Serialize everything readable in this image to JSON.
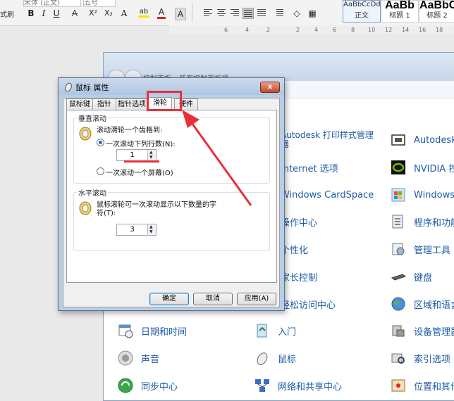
{
  "ribbon": {
    "format_painter_label": "式刷",
    "font_name": "宋体 (正文)",
    "font_size": "五号",
    "format_buttons": [
      "B",
      "I",
      "U",
      "A",
      "X²",
      "X₂",
      "A",
      "ab",
      "A",
      "A"
    ],
    "styles": [
      {
        "sample": "AaBbCcDd",
        "caption": "正文"
      },
      {
        "sample": "AaBb",
        "caption": "标题 1"
      },
      {
        "sample": "AaBbC",
        "caption": "标题 2"
      }
    ],
    "ruler_ticks": [
      "6",
      "4",
      "2",
      "2",
      "4",
      "6",
      "8",
      "10",
      "12",
      "14",
      "16",
      "18"
    ]
  },
  "control_panel": {
    "address": "控制面板 ▸ 所有控制面板项 ▸",
    "items": [
      {
        "label": "Autodesk 打印样式管理器",
        "icon": "printer-style-icon"
      },
      {
        "label": "Autodesk",
        "icon": "autodesk-icon"
      },
      {
        "label": "Internet 选项",
        "icon": "globe-icon"
      },
      {
        "label": "NVIDIA 控",
        "icon": "nvidia-icon"
      },
      {
        "label": "Windows CardSpace",
        "icon": "cardspace-icon"
      },
      {
        "label": "Windows",
        "icon": "windows-icon"
      },
      {
        "label": "操作中心",
        "icon": "flag-icon"
      },
      {
        "label": "程序和功能",
        "icon": "programs-icon"
      },
      {
        "label": "个性化",
        "icon": "personalize-icon"
      },
      {
        "label": "管理工具",
        "icon": "admin-tools-icon"
      },
      {
        "label": "家长控制",
        "icon": "parental-icon"
      },
      {
        "label": "键盘",
        "icon": "keyboard-icon"
      },
      {
        "label": "轻松访问中心",
        "icon": "ease-access-icon"
      },
      {
        "label": "区域和语言",
        "icon": "region-globe-icon"
      },
      {
        "label": "日期和时间",
        "icon": "calendar-clock-icon"
      },
      {
        "label": "入门",
        "icon": "getting-started-icon"
      },
      {
        "label": "设备管理器",
        "icon": "device-manager-icon"
      },
      {
        "label": "声音",
        "icon": "speaker-icon"
      },
      {
        "label": "鼠标",
        "icon": "mouse-icon"
      },
      {
        "label": "索引选项",
        "icon": "index-search-icon"
      },
      {
        "label": "同步中心",
        "icon": "sync-icon"
      },
      {
        "label": "网络和共享中心",
        "icon": "network-icon"
      },
      {
        "label": "位置和其他",
        "icon": "location-icon"
      }
    ]
  },
  "dialog": {
    "title": "鼠标 属性",
    "close": "x",
    "tabs": [
      "鼠标键",
      "指针",
      "指针选项",
      "滑轮",
      "硬件"
    ],
    "active_tab": "滑轮",
    "vertical": {
      "title": "垂直滚动",
      "prompt": "滚动滑轮一个齿格到:",
      "option_lines": "一次滚动下列行数(N):",
      "lines_value": "1",
      "option_screen": "一次滚动一个屏幕(O)"
    },
    "horizontal": {
      "title": "水平滚动",
      "prompt_line1": "鼠标滚轮可一次滚动显示以下数量的字",
      "prompt_line2": "符(T):",
      "chars_value": "3"
    },
    "buttons": {
      "ok": "确定",
      "cancel": "取消",
      "apply": "应用(A)"
    }
  },
  "colors": {
    "annotation_red": "#e8303a",
    "link_blue": "#1e5ba8"
  }
}
